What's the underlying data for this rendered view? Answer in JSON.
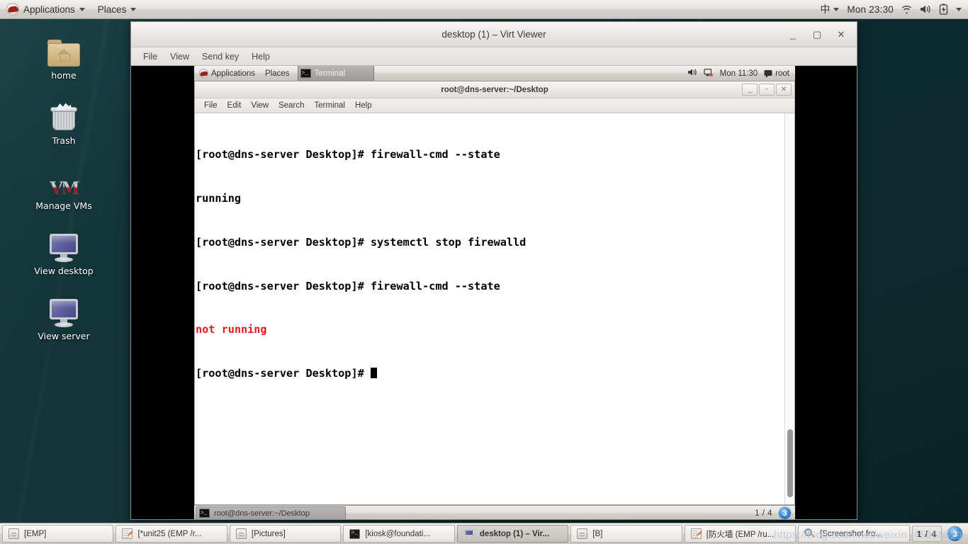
{
  "host": {
    "top_panel": {
      "logo": "redhat-logo-icon",
      "applications_label": "Applications",
      "places_label": "Places",
      "ime_label": "中",
      "clock": "Mon 23:30",
      "wifi_icon": "wifi-icon",
      "volume_icon": "volume-icon",
      "battery_icon": "battery-charging-icon"
    },
    "desktop_icons": [
      {
        "label": "home",
        "icon": "home-folder-icon"
      },
      {
        "label": "Trash",
        "icon": "trash-icon"
      },
      {
        "label": "Manage VMs",
        "icon": "vm-manager-icon"
      },
      {
        "label": "View desktop",
        "icon": "monitor-icon"
      },
      {
        "label": "View server",
        "icon": "monitor-icon"
      }
    ],
    "taskbar": {
      "buttons": [
        {
          "label": "[EMP]",
          "icon": "archive-icon",
          "active": false
        },
        {
          "label": "[*unit25 (EMP /r...",
          "icon": "text-editor-icon",
          "active": false
        },
        {
          "label": "[Pictures]",
          "icon": "archive-icon",
          "active": false
        },
        {
          "label": "[kiosk@foundati...",
          "icon": "terminal-icon",
          "active": false
        },
        {
          "label": "desktop (1) – Vir...",
          "icon": "monitor-icon",
          "active": true
        },
        {
          "label": "[B]",
          "icon": "archive-icon",
          "active": false
        },
        {
          "label": "[防火墙 (EMP /ru...",
          "icon": "text-editor-icon",
          "active": false
        },
        {
          "label": "[Screenshot fro...",
          "icon": "magnifier-icon",
          "active": false
        }
      ],
      "pager": "1 / 4",
      "badge": "3"
    },
    "watermark": "https://blog.csdn.net/weixin_45368529"
  },
  "virt_viewer": {
    "title": "desktop (1) – Virt Viewer",
    "window_buttons": {
      "minimize": "_",
      "maximize": "▢",
      "close": "✕"
    },
    "menu": [
      "File",
      "View",
      "Send key",
      "Help"
    ]
  },
  "guest": {
    "top_panel": {
      "applications_label": "Applications",
      "places_label": "Places",
      "active_task": "Terminal",
      "volume_icon": "volume-icon",
      "network_icon": "network-disconnected-icon",
      "clock": "Mon 11:30",
      "user": "root"
    },
    "terminal": {
      "title": "root@dns-server:~/Desktop",
      "menu": [
        "File",
        "Edit",
        "View",
        "Search",
        "Terminal",
        "Help"
      ],
      "window_buttons": {
        "minimize": "_",
        "maximize": "▫",
        "close": "✕"
      },
      "lines": [
        {
          "text": "[root@dns-server Desktop]# firewall-cmd --state",
          "color": "black"
        },
        {
          "text": "running",
          "color": "black"
        },
        {
          "text": "[root@dns-server Desktop]# systemctl stop firewalld",
          "color": "black"
        },
        {
          "text": "[root@dns-server Desktop]# firewall-cmd --state",
          "color": "black"
        },
        {
          "text": "not running",
          "color": "red"
        },
        {
          "text": "[root@dns-server Desktop]# ",
          "color": "black",
          "cursor": true
        }
      ],
      "colors": {
        "foreground": "#000000",
        "background": "#ffffff",
        "error": "#e01b24"
      }
    },
    "taskbar": {
      "task_label": "root@dns-server:~/Desktop",
      "task_icon": "terminal-icon",
      "pager": "1 / 4",
      "badge": "3"
    }
  }
}
